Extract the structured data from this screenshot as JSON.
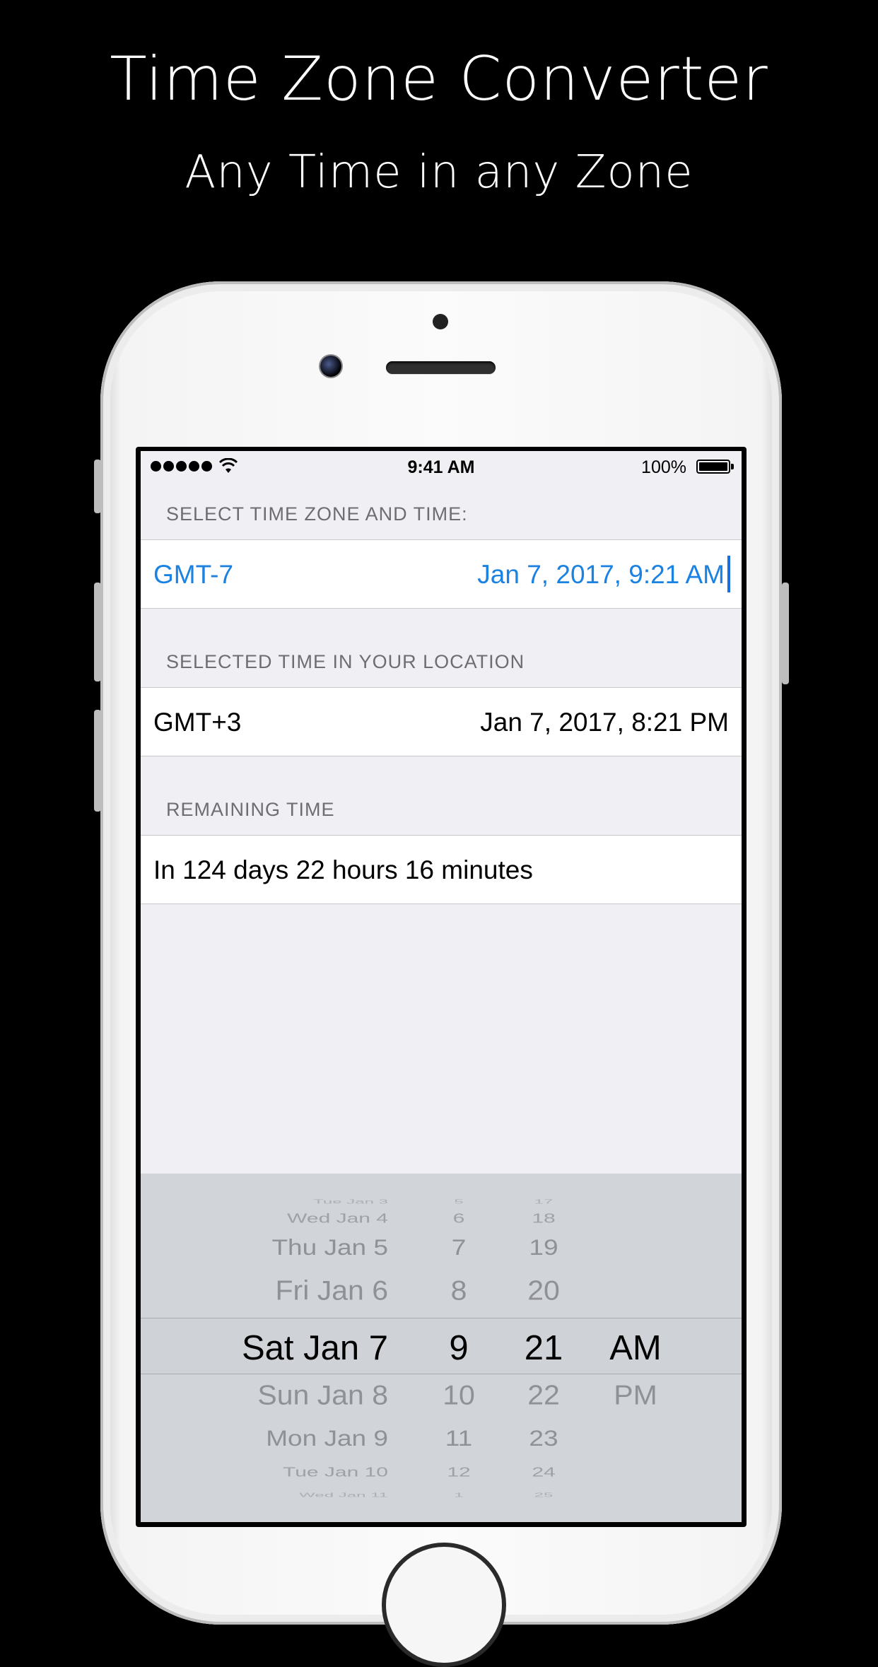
{
  "header": {
    "title": "Time Zone Converter",
    "subtitle": "Any Time in any Zone"
  },
  "status_bar": {
    "time": "9:41 AM",
    "battery": "100%",
    "signal_bars": 5
  },
  "sections": [
    {
      "header": "SELECT TIME ZONE AND TIME:",
      "left": "GMT-7",
      "right": "Jan 7, 2017, 9:21 AM"
    },
    {
      "header": "SELECTED TIME IN YOUR LOCATION",
      "left": "GMT+3",
      "right": "Jan 7, 2017, 8:21 PM"
    },
    {
      "header": "REMAINING TIME",
      "left": "In 124 days 22 hours 16 minutes"
    }
  ],
  "picker": {
    "dates": [
      "Tue Jan 3",
      "Wed Jan 4",
      "Thu Jan 5",
      "Fri Jan 6",
      "Sat Jan 7",
      "Sun Jan 8",
      "Mon Jan 9",
      "Tue Jan 10",
      "Wed Jan 11"
    ],
    "hours": [
      "5",
      "6",
      "7",
      "8",
      "9",
      "10",
      "11",
      "12",
      "1"
    ],
    "minutes": [
      "17",
      "18",
      "19",
      "20",
      "21",
      "22",
      "23",
      "24",
      "25"
    ],
    "periods": [
      "AM",
      "PM"
    ]
  }
}
